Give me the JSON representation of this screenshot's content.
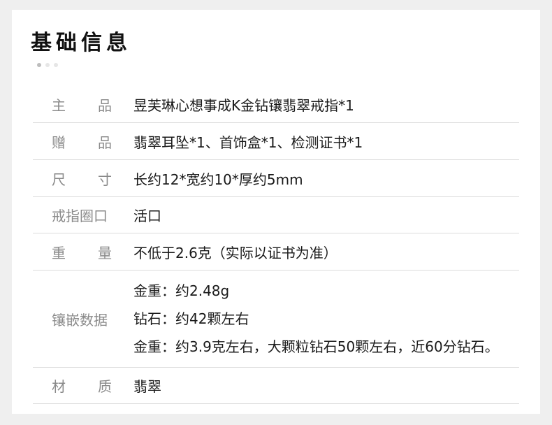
{
  "title": "基础信息",
  "rows": [
    {
      "label_chars": [
        "主",
        "品"
      ],
      "value": "昱芙琳心想事成K金钻镶翡翠戒指*1"
    },
    {
      "label_chars": [
        "赠",
        "品"
      ],
      "value": "翡翠耳坠*1、首饰盒*1、检测证书*1"
    },
    {
      "label_chars": [
        "尺",
        "寸"
      ],
      "value": "长约12*宽约10*厚约5mm"
    },
    {
      "label": "戒指圈口",
      "value": "活口"
    },
    {
      "label_chars": [
        "重",
        "量"
      ],
      "value": "不低于2.6克（实际以证书为准）"
    },
    {
      "label": "镶嵌数据",
      "values": [
        "金重：约2.48g",
        "钻石：约42颗左右",
        "金重：约3.9克左右，大颗粒钻石50颗左右，近60分钻石。"
      ]
    },
    {
      "label_chars": [
        "材",
        "质"
      ],
      "value": "翡翠"
    }
  ]
}
